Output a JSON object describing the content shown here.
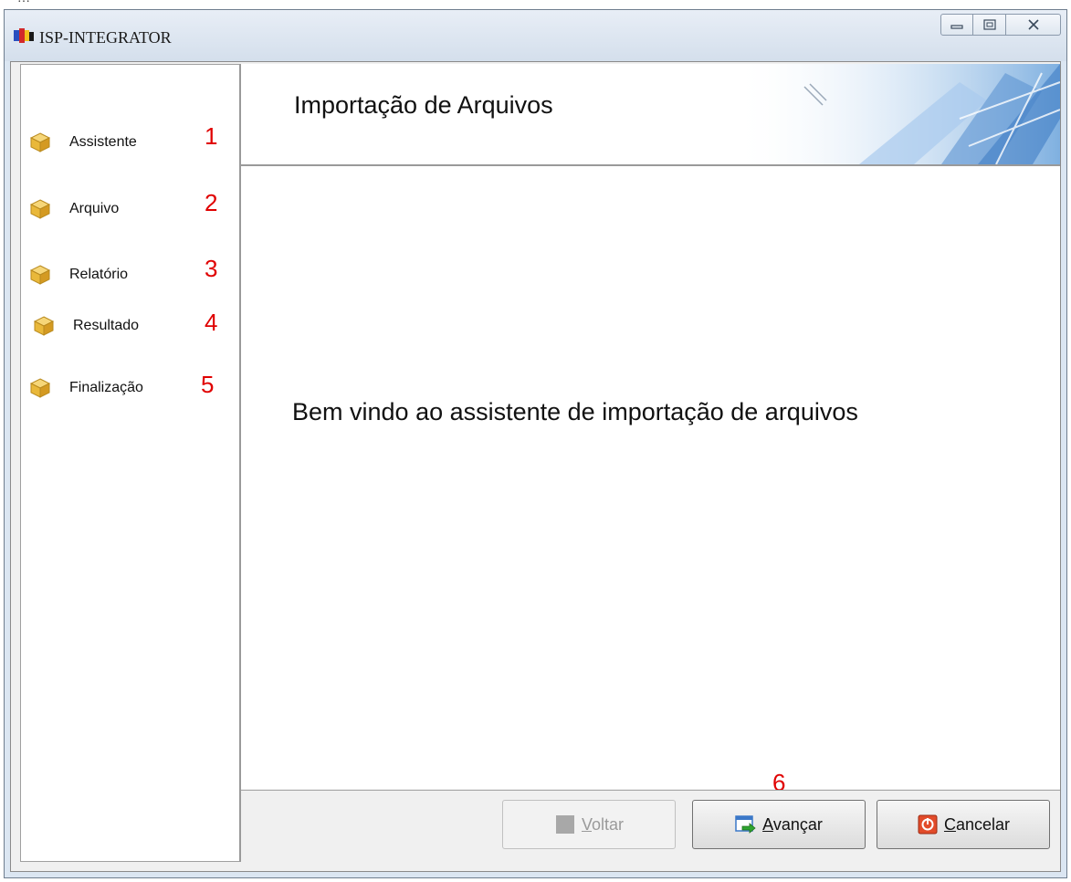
{
  "window": {
    "title": "ISP-INTEGRATOR",
    "controls": {
      "minimize": "minimize-icon",
      "maximize": "maximize-icon",
      "close": "close-icon"
    }
  },
  "sidebar": {
    "steps": [
      {
        "label": "Assistente",
        "marker": "1"
      },
      {
        "label": "Arquivo",
        "marker": "2"
      },
      {
        "label": "Relatório",
        "marker": "3"
      },
      {
        "label": "Resultado",
        "marker": "4"
      },
      {
        "label": "Finalização",
        "marker": "5"
      }
    ]
  },
  "header": {
    "title": "Importação de Arquivos"
  },
  "content": {
    "welcome": "Bem vindo ao assistente de importação de arquivos"
  },
  "annotations": {
    "buttons_marker": "6"
  },
  "footer": {
    "back": {
      "first": "V",
      "rest": "oltar",
      "enabled": false
    },
    "next": {
      "first": "A",
      "rest": "vançar",
      "enabled": true
    },
    "cancel": {
      "first": "C",
      "rest": "ancelar",
      "enabled": true
    }
  },
  "colors": {
    "marker": "#e00000",
    "titlebar": "#dbe6f2",
    "cube": "#e9b83a"
  }
}
